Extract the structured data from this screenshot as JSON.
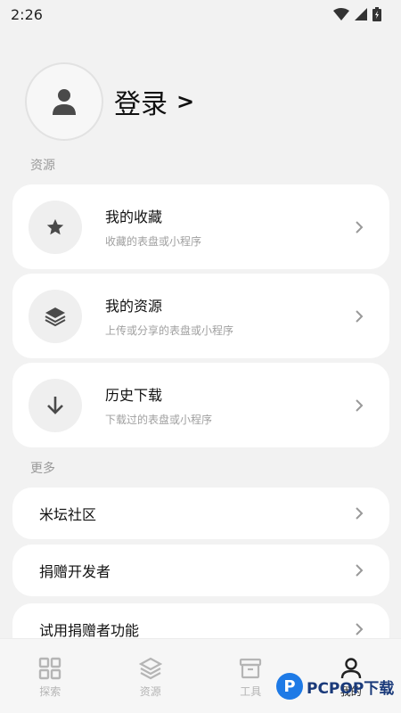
{
  "status": {
    "time": "2:26"
  },
  "profile": {
    "login": "登录",
    "arrow": ">"
  },
  "sections": {
    "resources": "资源",
    "more": "更多"
  },
  "resource_cards": [
    {
      "title": "我的收藏",
      "subtitle": "收藏的表盘或小程序",
      "icon": "star-icon"
    },
    {
      "title": "我的资源",
      "subtitle": "上传或分享的表盘或小程序",
      "icon": "layers-icon"
    },
    {
      "title": "历史下载",
      "subtitle": "下载过的表盘或小程序",
      "icon": "download-arrow-icon"
    }
  ],
  "more_items": [
    {
      "title": "米坛社区"
    },
    {
      "title": "捐赠开发者"
    },
    {
      "title": "试用捐赠者功能"
    }
  ],
  "tabs": [
    {
      "label": "探索",
      "icon": "grid-icon"
    },
    {
      "label": "资源",
      "icon": "layers-icon"
    },
    {
      "label": "工具",
      "icon": "toolbox-icon"
    },
    {
      "label": "我的",
      "icon": "person-icon",
      "active": true
    }
  ],
  "watermark": {
    "logo_letter": "P",
    "text": "PCPOP下载"
  }
}
